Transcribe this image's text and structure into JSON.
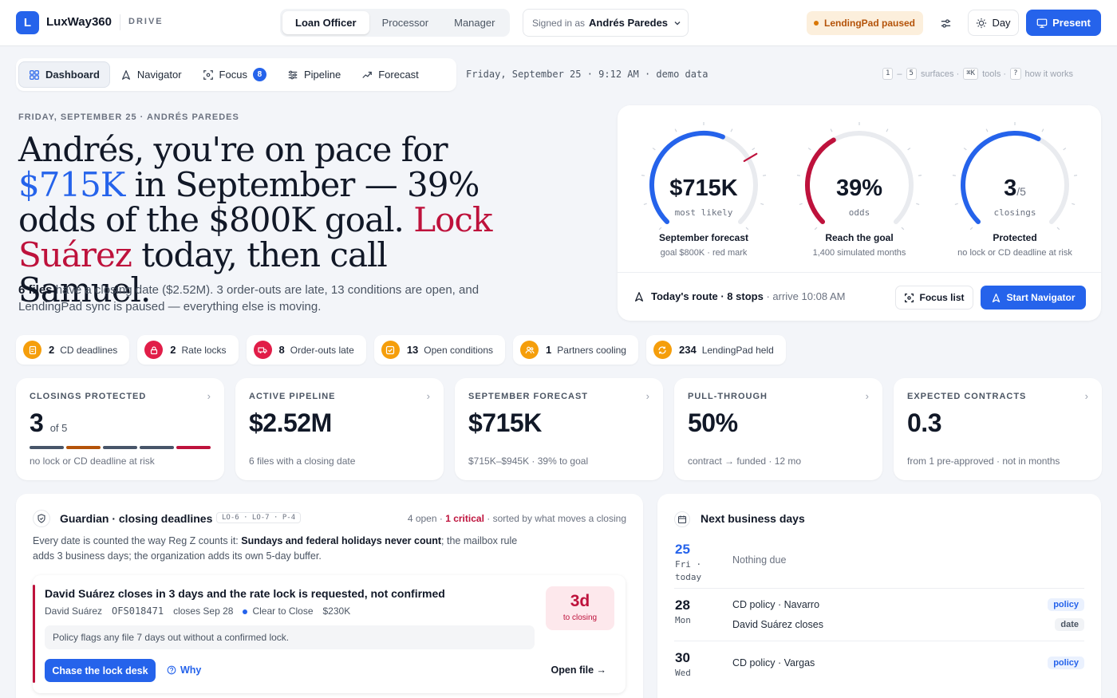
{
  "app": {
    "logo_letter": "L",
    "name": "LuxWay360",
    "section": "DRIVE"
  },
  "roles": [
    "Loan Officer",
    "Processor",
    "Manager"
  ],
  "signed_in": {
    "prefix": "Signed in as",
    "user": "Andrés Paredes"
  },
  "status": {
    "lendingpad": "LendingPad paused"
  },
  "toolbar": {
    "day_label": "Day",
    "present_label": "Present"
  },
  "nav": {
    "items": [
      {
        "label": "Dashboard",
        "icon": "grid-icon"
      },
      {
        "label": "Navigator",
        "icon": "navigation-icon"
      },
      {
        "label": "Focus",
        "icon": "focus-icon",
        "badge": "8"
      },
      {
        "label": "Pipeline",
        "icon": "sliders-icon"
      },
      {
        "label": "Forecast",
        "icon": "trend-icon"
      }
    ],
    "date_line": "Friday, September 25 · 9:12 AM · demo data",
    "shortcuts": {
      "k1": "1",
      "dash": "–",
      "k5": "5",
      "surfaces": "surfaces ·",
      "kcmd": "⌘K",
      "tools": "tools ·",
      "kq": "?",
      "how": "how it works"
    }
  },
  "hero": {
    "eyebrow": "FRIDAY, SEPTEMBER 25 · ANDRÉS PAREDES",
    "h_a": "Andrés, you're on pace for",
    "h_amount": "$715K",
    "h_b": "in September — 39% odds of the $800K goal.",
    "h_lock": "Lock Suárez",
    "h_c": "today, then call Samuel.",
    "sub_bold": "6 files",
    "sub_rest": "have a closing date ($2.52M). 3 order-outs are late, 13 conditions are open, and LendingPad sync is paused — everything else is moving."
  },
  "gauges": [
    {
      "value": "$715K",
      "suffix": "",
      "unit": "most likely",
      "title": "September forecast",
      "sub": "goal $800K · red mark",
      "fill": 0.58,
      "color": "#2563eb",
      "marker": 0.72
    },
    {
      "value": "39%",
      "suffix": "",
      "unit": "odds",
      "title": "Reach the goal",
      "sub": "1,400 simulated months",
      "fill": 0.39,
      "color": "#be123c"
    },
    {
      "value": "3",
      "suffix": "/5",
      "unit": "closings",
      "title": "Protected",
      "sub": "no lock or CD deadline at risk",
      "fill": 0.6,
      "color": "#2563eb"
    }
  ],
  "route": {
    "title": "Today's route · 8 stops",
    "arrive": "· arrive 10:08 AM",
    "focus_label": "Focus list",
    "start_label": "Start Navigator"
  },
  "chips": [
    {
      "count": "2",
      "label": "CD deadlines",
      "color": "#f59e0b",
      "icon": "document-icon"
    },
    {
      "count": "2",
      "label": "Rate locks",
      "color": "#e11d48",
      "icon": "lock-icon"
    },
    {
      "count": "8",
      "label": "Order-outs late",
      "color": "#e11d48",
      "icon": "truck-icon"
    },
    {
      "count": "13",
      "label": "Open conditions",
      "color": "#f59e0b",
      "icon": "checkbox-icon"
    },
    {
      "count": "1",
      "label": "Partners cooling",
      "color": "#f59e0b",
      "icon": "users-icon"
    },
    {
      "count": "234",
      "label": "LendingPad held",
      "color": "#f59e0b",
      "icon": "sync-icon"
    }
  ],
  "kpis": [
    {
      "label": "CLOSINGS PROTECTED",
      "value": "3",
      "suffix": "of 5",
      "desc": "no lock or CD deadline at risk",
      "segments": [
        "#475569",
        "#b45309",
        "#475569",
        "#475569",
        "#be123c"
      ]
    },
    {
      "label": "ACTIVE PIPELINE",
      "value": "$2.52M",
      "suffix": "",
      "desc": "6 files with a closing date"
    },
    {
      "label": "SEPTEMBER FORECAST",
      "value": "$715K",
      "suffix": "",
      "desc": "$715K–$945K · 39% to goal"
    },
    {
      "label": "PULL-THROUGH",
      "value": "50%",
      "suffix": "",
      "desc": "contract → funded · 12 mo"
    },
    {
      "label": "EXPECTED CONTRACTS",
      "value": "0.3",
      "suffix": "",
      "desc": "from 1 pre-approved · not in months"
    }
  ],
  "guardian": {
    "title": "Guardian · closing deadlines",
    "tags": "LO-6 · LO-7 · P-4",
    "open": "4 open ·",
    "critical": "1 critical",
    "sorted": "· sorted by what moves a closing",
    "desc_a": "Every date is counted the way Reg Z counts it:",
    "desc_bold": "Sundays and federal holidays never count",
    "desc_b": "; the mailbox rule adds 3 business days; the organization adds its own 5-day buffer.",
    "alert": {
      "title": "David Suárez closes in 3 days and the rate lock is requested, not confirmed",
      "borrower": "David Suárez",
      "file_id": "OFS018471",
      "closes": "closes Sep 28",
      "stage": "Clear to Close",
      "amount": "$230K",
      "note": "Policy flags any file 7 days out without a confirmed lock.",
      "badge_value": "3d",
      "badge_label": "to closing",
      "chase_label": "Chase the lock desk",
      "why_label": "Why",
      "open_label": "Open file →"
    }
  },
  "next_days": {
    "title": "Next business days",
    "days": [
      {
        "num": "25",
        "dow": "Fri ·",
        "extra": "today",
        "today": true,
        "events": [
          {
            "text": "Nothing due",
            "muted": true
          }
        ]
      },
      {
        "num": "28",
        "dow": "Mon",
        "extra": "",
        "events": [
          {
            "text": "CD policy · Navarro",
            "tag": "policy"
          },
          {
            "text": "David Suárez closes",
            "tag": "date"
          }
        ]
      },
      {
        "num": "30",
        "dow": "Wed",
        "extra": "",
        "events": [
          {
            "text": "CD policy · Vargas",
            "tag": "policy"
          }
        ]
      }
    ]
  }
}
